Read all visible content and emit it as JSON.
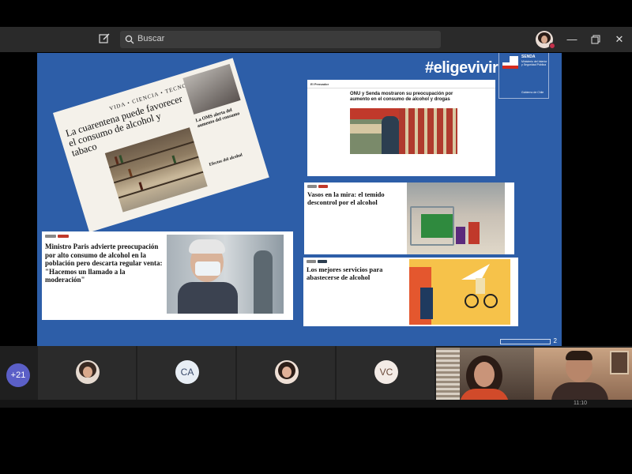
{
  "toolbar": {
    "search_placeholder": "Buscar",
    "window_controls": [
      "minimize-icon",
      "restore-icon",
      "close-icon"
    ]
  },
  "slide": {
    "brand": "#eligevivir",
    "brand_sub": "",
    "page_number": "2",
    "org": {
      "name": "SENDA",
      "ministry": "Ministerio del Interior y Seguridad Pública",
      "government": "Gobierno de Chile"
    }
  },
  "articles": {
    "newspaper": {
      "section": "VIDA • CIENCIA • TECNOLOGÍA",
      "headline": "La cuarentena puede favorecer el consumo de alcohol y tabaco",
      "side_headline": "La OMS alerta del aumento del consumo",
      "side_headline_2": "Efectos del alcohol"
    },
    "card2": {
      "source": "El Pensador",
      "title": "ONU y Senda mostraron su preocupación por aumento en el consumo de alcohol y drogas"
    },
    "card3": {
      "title": "Vasos en la mira: el temido descontrol por el alcohol"
    },
    "card4": {
      "title": "Ministro Paris advierte preocupación por alto consumo de alcohol en la población pero descarta regular venta: \"Hacemos un llamado a la moderación\""
    },
    "card5": {
      "title": "Los mejores servicios para abastecerse de alcohol"
    }
  },
  "participants": {
    "overflow_count": "+21",
    "tiles": [
      {
        "type": "photo",
        "name": "participant-1"
      },
      {
        "type": "initials",
        "initials": "CA"
      },
      {
        "type": "photo",
        "name": "participant-3"
      },
      {
        "type": "initials",
        "initials": "VC"
      }
    ]
  },
  "status": {
    "clock": "11:10"
  },
  "colors": {
    "slide_bg": "#2d5ea8",
    "accent": "#5b5fc7",
    "presence_busy": "#c4314b"
  }
}
